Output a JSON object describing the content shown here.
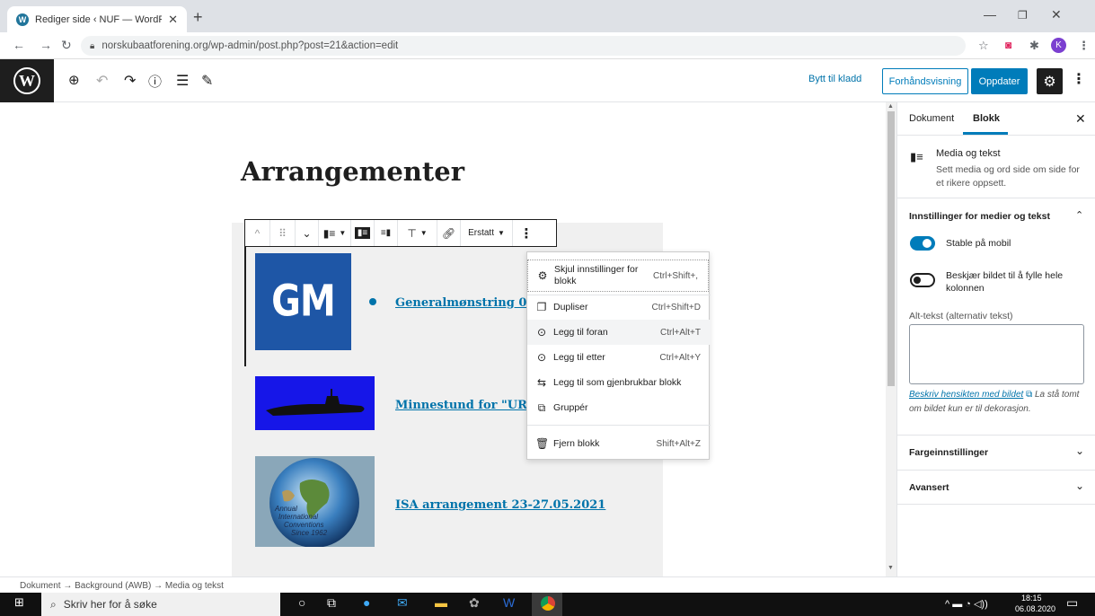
{
  "browser": {
    "tab_title": "Rediger side ‹ NUF — WordPress",
    "url": "norskubaatforening.org/wp-admin/post.php?post=21&action=edit",
    "profile_initial": "K"
  },
  "toolbar": {
    "switch_to_draft": "Bytt til kladd",
    "preview": "Forhåndsvisning",
    "update": "Oppdater"
  },
  "editor": {
    "page_title": "Arrangementer",
    "block_toolbar": {
      "replace_label": "Erstatt"
    },
    "media_gm_text": "GM",
    "items": [
      {
        "link": "Generalmønstring 05.0"
      },
      {
        "link": "Minnestund for \"URÆD"
      },
      {
        "link": "ISA arrangement  23-27.05.2021"
      }
    ],
    "globe_caption": [
      "Annual",
      "International",
      "Conventions",
      "Since 1962"
    ]
  },
  "block_menu": {
    "items": [
      {
        "icon": "gear-icon",
        "label": "Skjul innstillinger for blokk",
        "shortcut": "Ctrl+Shift+,"
      },
      {
        "icon": "duplicate-icon",
        "label": "Dupliser",
        "shortcut": "Ctrl+Shift+D"
      },
      {
        "icon": "insert-before-icon",
        "label": "Legg til foran",
        "shortcut": "Ctrl+Alt+T"
      },
      {
        "icon": "insert-after-icon",
        "label": "Legg til etter",
        "shortcut": "Ctrl+Alt+Y"
      },
      {
        "icon": "reusable-block-icon",
        "label": "Legg til som gjenbrukbar blokk",
        "shortcut": ""
      },
      {
        "icon": "group-icon",
        "label": "Gruppér",
        "shortcut": ""
      },
      {
        "icon": "trash-icon",
        "label": "Fjern blokk",
        "shortcut": "Shift+Alt+Z"
      }
    ]
  },
  "sidebar": {
    "tab_document": "Dokument",
    "tab_block": "Blokk",
    "block_name": "Media og tekst",
    "block_desc": "Sett media og ord side om side for et rikere oppsett.",
    "panel_media_title": "Innstillinger for medier og tekst",
    "stack_mobile": "Stable på mobil",
    "crop_fill": "Beskjær bildet til å fylle hele kolonnen",
    "alt_label": "Alt-tekst (alternativ tekst)",
    "alt_link": "Beskriv hensikten med bildet",
    "alt_help": " La stå tomt om bildet kun er til dekorasjon.",
    "panel_color": "Fargeinnstillinger",
    "panel_advanced": "Avansert"
  },
  "breadcrumb": "Dokument  →  Background (AWB)  →  Media og tekst",
  "taskbar": {
    "search_placeholder": "Skriv her for å søke",
    "time": "18:15",
    "date": "06.08.2020"
  }
}
